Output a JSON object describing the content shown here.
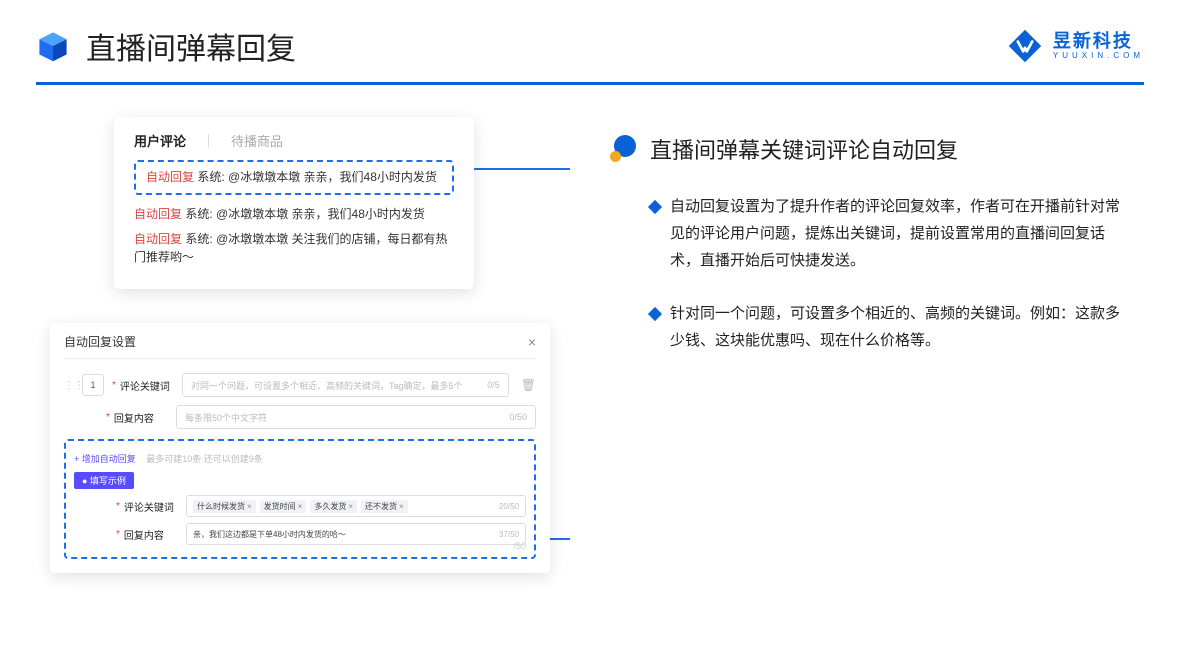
{
  "header": {
    "title": "直播间弹幕回复",
    "brand_cn": "昱新科技",
    "brand_url": "YUUXIN.COM"
  },
  "comments_panel": {
    "tab_active": "用户评论",
    "tab_idle": "待播商品",
    "highlighted": {
      "label": "自动回复",
      "text": "系统: @冰墩墩本墩 亲亲，我们48小时内发货"
    },
    "rows": [
      {
        "label": "自动回复",
        "text": "系统: @冰墩墩本墩 亲亲，我们48小时内发货"
      },
      {
        "label": "自动回复",
        "text": "系统: @冰墩墩本墩 关注我们的店铺，每日都有热门推荐哟～"
      }
    ]
  },
  "settings_panel": {
    "title": "自动回复设置",
    "number": "1",
    "field_keyword": "评论关键词",
    "keyword_placeholder": "对同一个问题，可设置多个相近、高频的关键词，Tag确定，最多5个",
    "keyword_count": "0/5",
    "field_content": "回复内容",
    "content_placeholder": "每条限50个中文字符",
    "content_count": "0/50",
    "add_link": "+ 增加自动回复",
    "add_hint": "最多可建10条 还可以创建9条",
    "example_badge": "● 填写示例",
    "example_keyword_label": "评论关键词",
    "tags": [
      "什么时候发货",
      "发货时间",
      "多久发货",
      "还不发货"
    ],
    "tags_count": "20/50",
    "example_content_label": "回复内容",
    "example_content_value": "亲，我们这边都是下单48小时内发货的哈～",
    "example_content_count": "37/50",
    "ghost_count": "/50"
  },
  "right": {
    "section_title": "直播间弹幕关键词评论自动回复",
    "para1": "自动回复设置为了提升作者的评论回复效率，作者可在开播前针对常见的评论用户问题，提炼出关键词，提前设置常用的直播间回复话术，直播开始后可快捷发送。",
    "para2": "针对同一个问题，可设置多个相近的、高频的关键词。例如：这款多少钱、这块能优惠吗、现在什么价格等。"
  }
}
